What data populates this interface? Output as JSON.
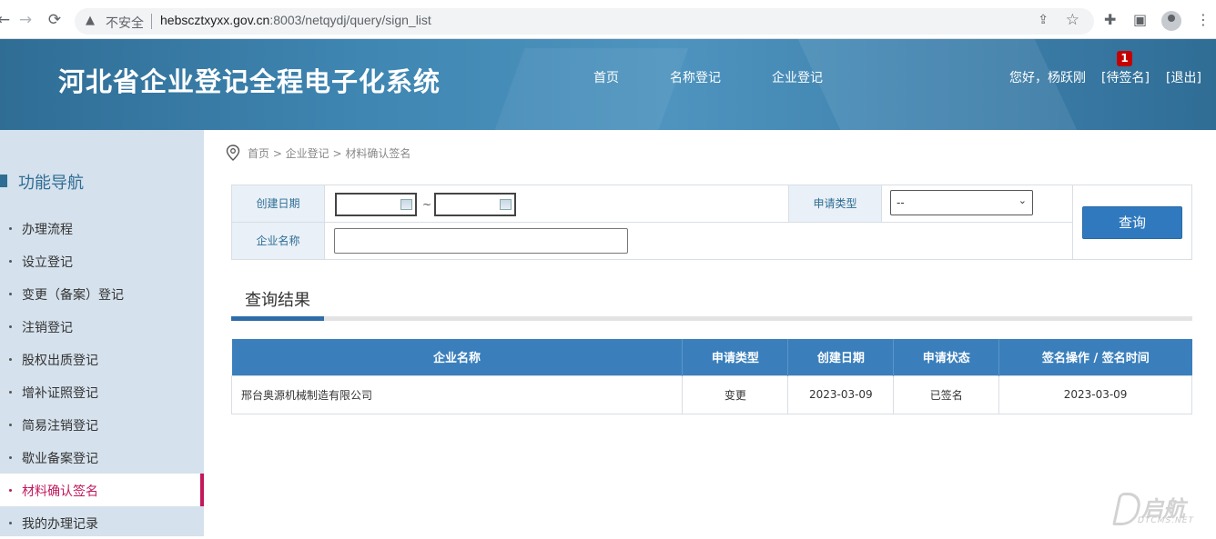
{
  "browser": {
    "insecure_label": "不安全",
    "url_host": "hebscztxyxx.gov.cn",
    "url_path": ":8003/netqydj/query/sign_list"
  },
  "header": {
    "title": "河北省企业登记全程电子化系统",
    "nav": [
      "首页",
      "名称登记",
      "企业登记"
    ],
    "greeting": "您好，杨跃刚",
    "pending_label": "[待签名]",
    "pending_count": "1",
    "logout_label": "[退出]"
  },
  "sidebar": {
    "title": "功能导航",
    "items": [
      {
        "label": "办理流程",
        "active": false
      },
      {
        "label": "设立登记",
        "active": false
      },
      {
        "label": "变更（备案）登记",
        "active": false
      },
      {
        "label": "注销登记",
        "active": false
      },
      {
        "label": "股权出质登记",
        "active": false
      },
      {
        "label": "增补证照登记",
        "active": false
      },
      {
        "label": "简易注销登记",
        "active": false
      },
      {
        "label": "歇业备案登记",
        "active": false
      },
      {
        "label": "材料确认签名",
        "active": true
      },
      {
        "label": "我的办理记录",
        "active": false
      }
    ]
  },
  "breadcrumb": {
    "text": "首页 > 企业登记 > 材料确认签名"
  },
  "search": {
    "create_date_label": "创建日期",
    "date_separator": "~",
    "apply_type_label": "申请类型",
    "apply_type_value": "--",
    "company_name_label": "企业名称",
    "query_button": "查询"
  },
  "results": {
    "title": "查询结果",
    "columns": [
      "企业名称",
      "申请类型",
      "创建日期",
      "申请状态",
      "签名操作 / 签名时间"
    ],
    "rows": [
      [
        "邢台奥源机械制造有限公司",
        "变更",
        "2023-03-09",
        "已签名",
        "2023-03-09"
      ]
    ]
  },
  "watermark": {
    "main": "启航",
    "sub": "DTCMS.NET"
  }
}
